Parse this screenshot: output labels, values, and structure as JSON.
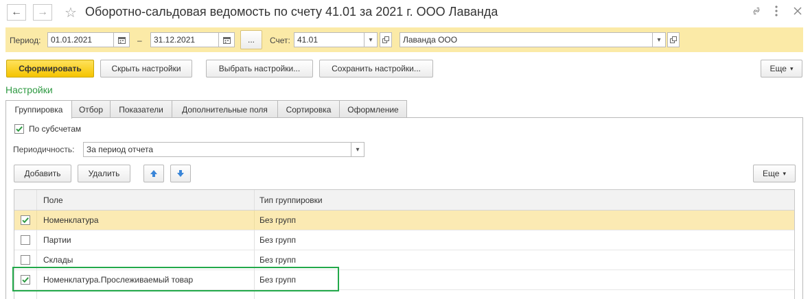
{
  "window": {
    "title": "Оборотно-сальдовая ведомость по счету 41.01 за 2021 г. ООО Лаванда"
  },
  "period_panel": {
    "period_label": "Период:",
    "date_from": "01.01.2021",
    "dash": "–",
    "date_to": "31.12.2021",
    "ellipsis_label": "...",
    "account_label": "Счет:",
    "account_value": "41.01",
    "organization_value": "Лаванда ООО"
  },
  "toolbar": {
    "generate_label": "Сформировать",
    "hide_settings_label": "Скрыть настройки",
    "choose_settings_label": "Выбрать настройки...",
    "save_settings_label": "Сохранить настройки...",
    "more_label": "Еще"
  },
  "settings": {
    "title": "Настройки",
    "tabs": [
      {
        "label": "Группировка"
      },
      {
        "label": "Отбор"
      },
      {
        "label": "Показатели"
      },
      {
        "label": "Дополнительные поля"
      },
      {
        "label": "Сортировка"
      },
      {
        "label": "Оформление"
      }
    ],
    "by_subaccounts_label": "По субсчетам",
    "by_subaccounts_checked": true,
    "periodicity_label": "Периодичность:",
    "periodicity_value": "За период отчета",
    "add_label": "Добавить",
    "delete_label": "Удалить",
    "more_label": "Еще"
  },
  "grouping_table": {
    "columns": [
      "Поле",
      "Тип группировки"
    ],
    "rows": [
      {
        "field": "Номенклатура",
        "type": "Без групп",
        "checked": true
      },
      {
        "field": "Партии",
        "type": "Без групп",
        "checked": false
      },
      {
        "field": "Склады",
        "type": "Без групп",
        "checked": false
      },
      {
        "field": "Номенклатура.Прослеживаемый товар",
        "type": "Без групп",
        "checked": true
      }
    ]
  },
  "colors": {
    "accent_yellow": "#f5c400",
    "panel_yellow": "#fbeaa7",
    "selected_row": "#fbeab3",
    "section_green": "#2e9a42",
    "highlight_green": "#22a94a",
    "arrow_blue": "#3a86d8"
  },
  "icons": [
    "back-arrow-icon",
    "forward-arrow-icon",
    "star-icon",
    "link-icon",
    "kebab-menu-icon",
    "close-icon",
    "calendar-icon",
    "dropdown-arrow-icon",
    "open-icon",
    "check-icon",
    "arrow-up-icon",
    "arrow-down-icon"
  ]
}
